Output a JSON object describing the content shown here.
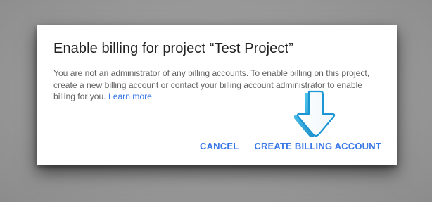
{
  "dialog": {
    "title": "Enable billing for project “Test Project”",
    "body_text": "You are not an administrator of any billing accounts. To enable billing on this project, create a new billing account or contact your billing account administrator to enable billing for you.",
    "learn_more_label": "Learn more",
    "cancel_label": "CANCEL",
    "create_label": "CREATE BILLING ACCOUNT"
  },
  "annotation": {
    "icon": "down-arrow-icon",
    "color": "#29b6e8"
  },
  "colors": {
    "accent": "#3b78e7",
    "title": "#212121",
    "body": "#616161",
    "backdrop": "#999999"
  }
}
